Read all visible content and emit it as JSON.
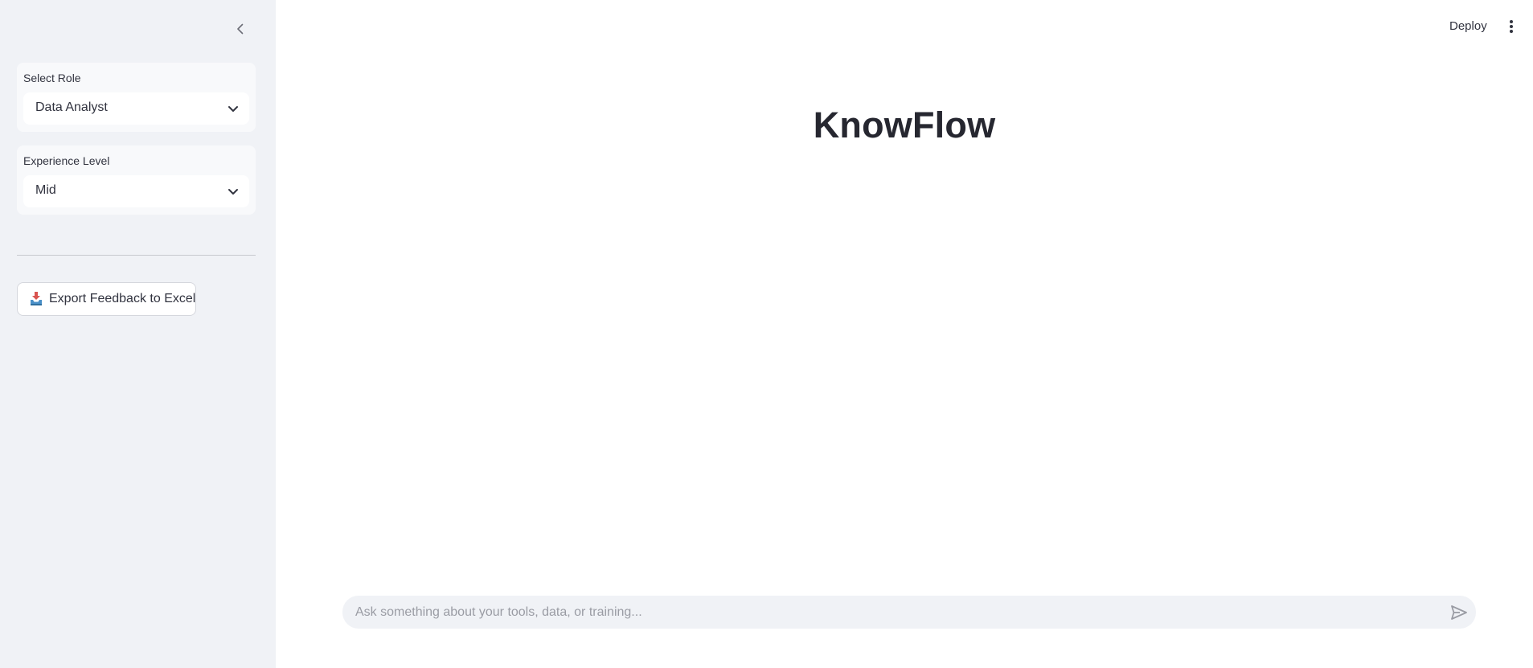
{
  "sidebar": {
    "collapse_icon": "chevron-left-icon",
    "role_select": {
      "label": "Select Role",
      "value": "Data Analyst",
      "icon": "chevron-down-icon"
    },
    "experience_select": {
      "label": "Experience Level",
      "value": "Mid",
      "icon": "chevron-down-icon"
    },
    "export_button": {
      "icon": "inbox-tray-icon",
      "label": "Export Feedback to Excel"
    }
  },
  "header": {
    "deploy_label": "Deploy",
    "menu_icon": "kebab-menu-icon"
  },
  "main": {
    "title": "KnowFlow"
  },
  "chat": {
    "placeholder": "Ask something about your tools, data, or training...",
    "value": "",
    "send_icon": "send-icon"
  },
  "colors": {
    "sidebar_bg": "#f0f2f6",
    "text": "#31333f",
    "title": "#262730",
    "chat_bg": "#f0f2f6",
    "placeholder": "#9a9ca4"
  }
}
